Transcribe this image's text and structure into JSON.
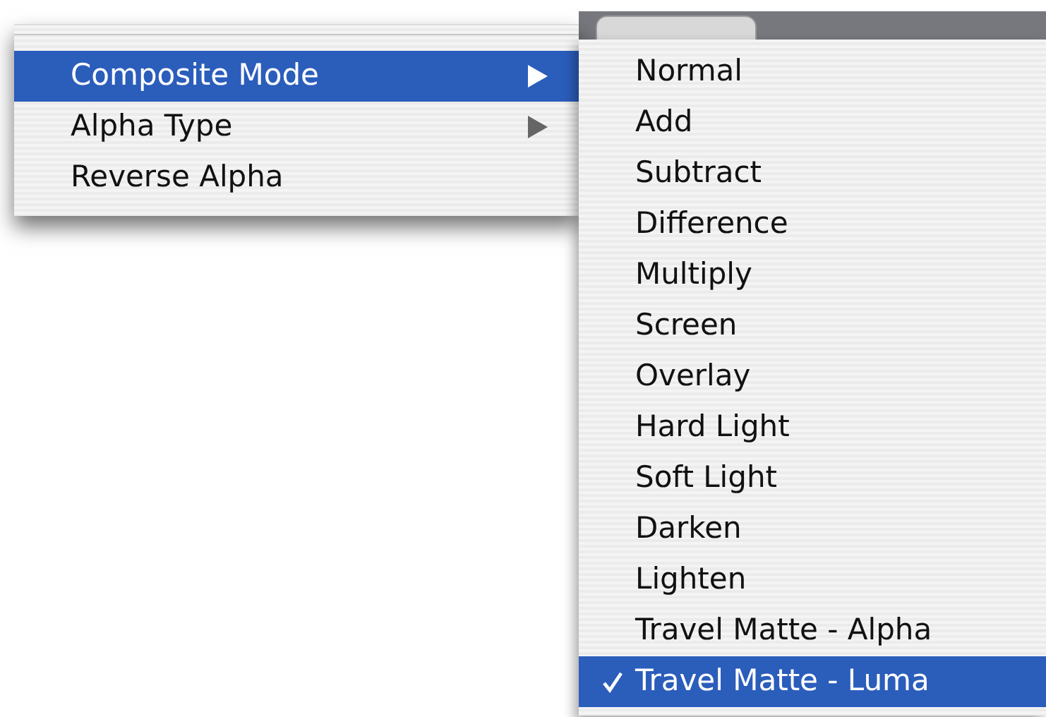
{
  "menu": {
    "items": [
      {
        "label": "Composite Mode",
        "has_submenu": true,
        "selected": true
      },
      {
        "label": "Alpha Type",
        "has_submenu": true,
        "selected": false
      },
      {
        "label": "Reverse Alpha",
        "has_submenu": false,
        "selected": false
      }
    ]
  },
  "submenu": {
    "items": [
      {
        "label": "Normal",
        "checked": false,
        "selected": false
      },
      {
        "label": "Add",
        "checked": false,
        "selected": false
      },
      {
        "label": "Subtract",
        "checked": false,
        "selected": false
      },
      {
        "label": "Difference",
        "checked": false,
        "selected": false
      },
      {
        "label": "Multiply",
        "checked": false,
        "selected": false
      },
      {
        "label": "Screen",
        "checked": false,
        "selected": false
      },
      {
        "label": "Overlay",
        "checked": false,
        "selected": false
      },
      {
        "label": "Hard Light",
        "checked": false,
        "selected": false
      },
      {
        "label": "Soft Light",
        "checked": false,
        "selected": false
      },
      {
        "label": "Darken",
        "checked": false,
        "selected": false
      },
      {
        "label": "Lighten",
        "checked": false,
        "selected": false
      },
      {
        "label": "Travel Matte - Alpha",
        "checked": false,
        "selected": false
      },
      {
        "label": "Travel Matte - Luma",
        "checked": true,
        "selected": true
      }
    ]
  }
}
